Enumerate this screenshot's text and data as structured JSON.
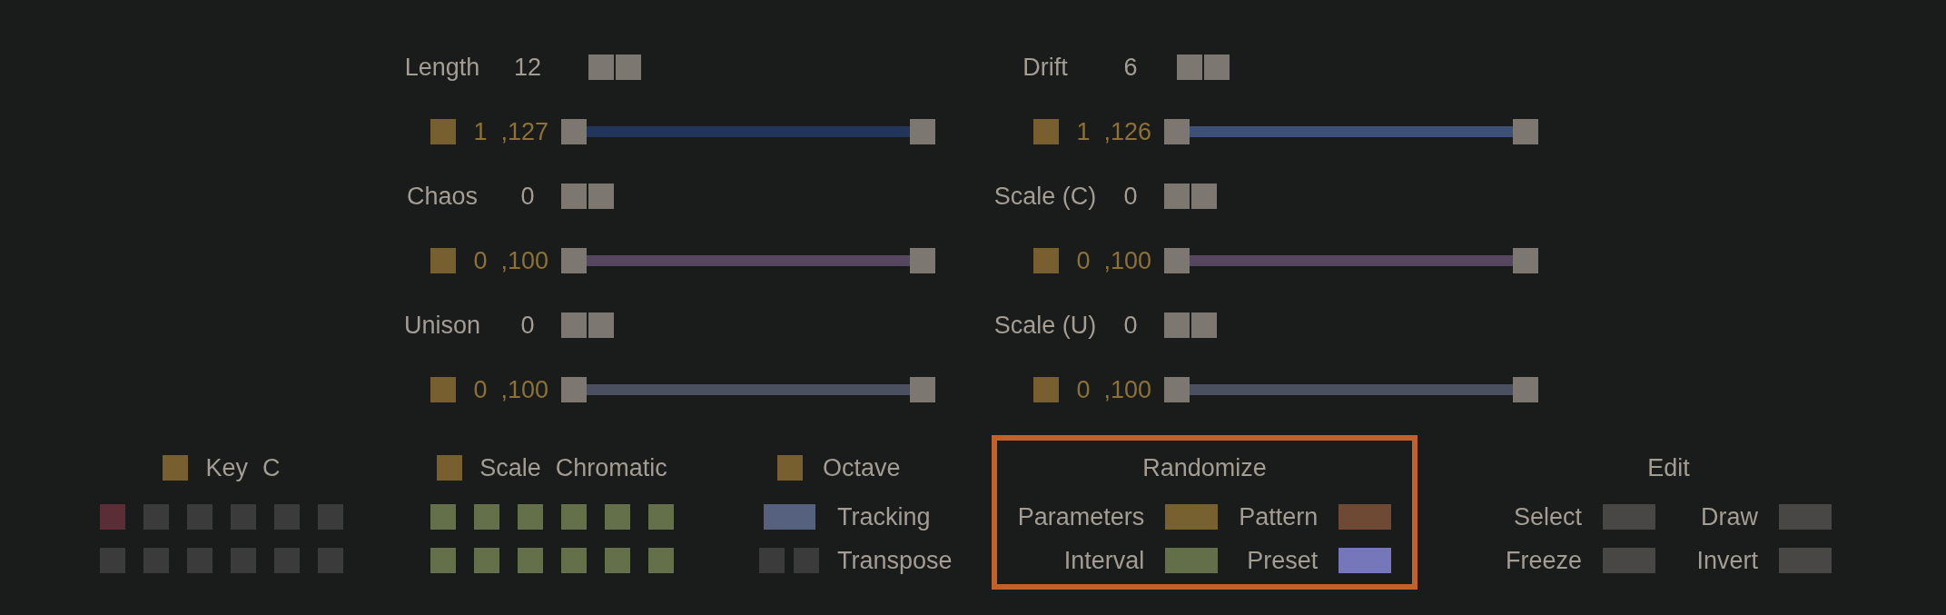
{
  "parameter_columns": [
    {
      "parameters": [
        {
          "label": "Length",
          "value": "12",
          "range": {
            "enabled": true,
            "min": "1",
            "max": ",127",
            "color": "#22365a",
            "thumbs": [
              {
                "level": 0
              },
              {
                "level": 1
              }
            ]
          }
        },
        {
          "label": "Chaos",
          "value": "0",
          "range": {
            "enabled": true,
            "min": "0",
            "max": ",100",
            "color": "#574660",
            "thumbs": [
              {
                "level": 0
              },
              {
                "level": 1
              }
            ]
          }
        },
        {
          "label": "Unison",
          "value": "0",
          "range": {
            "enabled": true,
            "min": "0",
            "max": ",100",
            "color": "#4a5060",
            "thumbs": [
              {
                "level": 0
              },
              {
                "level": 1
              }
            ]
          }
        }
      ]
    },
    {
      "parameters": [
        {
          "label": "Drift",
          "value": "6",
          "range": {
            "enabled": true,
            "min": "1",
            "max": ",126",
            "color": "#3d5078",
            "thumbs": [
              {
                "level": 0
              },
              {
                "level": 1
              }
            ]
          }
        },
        {
          "label": "Scale (C)",
          "value": "0",
          "range": {
            "enabled": true,
            "min": "0",
            "max": ",100",
            "color": "#574660",
            "thumbs": [
              {
                "level": 0
              },
              {
                "level": 1
              }
            ]
          }
        },
        {
          "label": "Scale (U)",
          "value": "0",
          "range": {
            "enabled": true,
            "min": "0",
            "max": ",100",
            "color": "#4a5060",
            "thumbs": [
              {
                "level": 0
              },
              {
                "level": 1
              }
            ]
          }
        }
      ]
    }
  ],
  "key": {
    "enabled": true,
    "label": "Key",
    "value": "C",
    "notes": [
      {
        "selected": true
      },
      {
        "selected": false
      },
      {
        "selected": false
      },
      {
        "selected": false
      },
      {
        "selected": false
      },
      {
        "selected": false
      },
      {
        "selected": false
      },
      {
        "selected": false
      },
      {
        "selected": false
      },
      {
        "selected": false
      },
      {
        "selected": false
      },
      {
        "selected": false
      }
    ]
  },
  "scale": {
    "enabled": true,
    "label": "Scale",
    "value": "Chromatic",
    "notes": [
      {
        "on": true
      },
      {
        "on": true
      },
      {
        "on": true
      },
      {
        "on": true
      },
      {
        "on": true
      },
      {
        "on": true
      },
      {
        "on": true
      },
      {
        "on": true
      },
      {
        "on": true
      },
      {
        "on": true
      },
      {
        "on": true
      },
      {
        "on": true
      }
    ]
  },
  "octave": {
    "enabled": true,
    "label": "Octave",
    "tracking": {
      "label": "Tracking",
      "on": true
    },
    "transpose": {
      "label": "Transpose"
    }
  },
  "randomize": {
    "title": "Randomize",
    "highlighted": true,
    "options": [
      {
        "label": "Parameters",
        "color": "#776130"
      },
      {
        "label": "Pattern",
        "color": "#6e4a35"
      },
      {
        "label": "Interval",
        "color": "#626f48"
      },
      {
        "label": "Preset",
        "color": "#7676bb"
      }
    ]
  },
  "edit": {
    "title": "Edit",
    "options": [
      {
        "label": "Select",
        "on": false
      },
      {
        "label": "Draw",
        "on": false
      },
      {
        "label": "Freeze",
        "on": false
      },
      {
        "label": "Invert",
        "on": false
      }
    ]
  }
}
